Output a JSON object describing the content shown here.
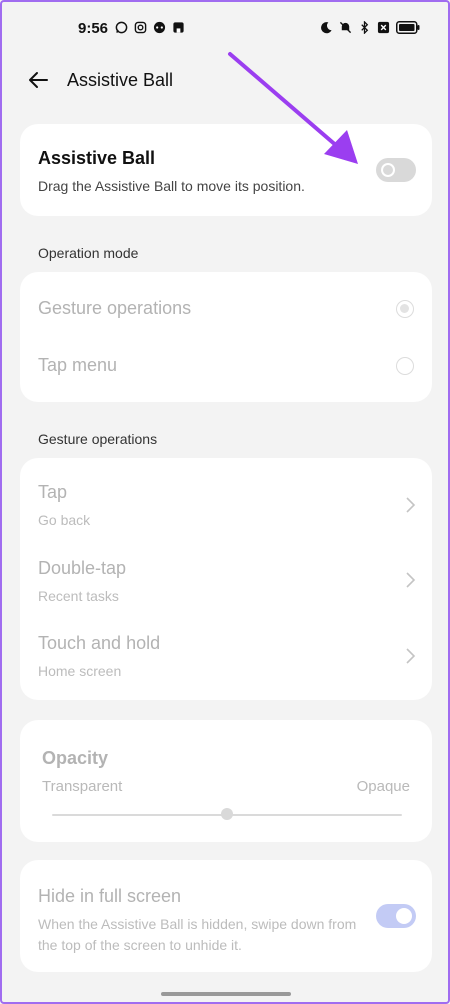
{
  "status_bar": {
    "time": "9:56",
    "left_icons": [
      "whatsapp-icon",
      "instagram-icon",
      "messenger-icon",
      "app-icon"
    ],
    "right_icons": [
      "moon-icon",
      "mute-icon",
      "bluetooth-icon",
      "close-box-icon",
      "battery-icon"
    ]
  },
  "header": {
    "title": "Assistive Ball"
  },
  "assistive_ball": {
    "title": "Assistive Ball",
    "description": "Drag the Assistive Ball to move its position.",
    "enabled": false
  },
  "operation_mode": {
    "label": "Operation mode",
    "options": [
      {
        "label": "Gesture operations",
        "selected": true
      },
      {
        "label": "Tap menu",
        "selected": false
      }
    ]
  },
  "gesture_operations": {
    "label": "Gesture operations",
    "items": [
      {
        "title": "Tap",
        "subtitle": "Go back"
      },
      {
        "title": "Double-tap",
        "subtitle": "Recent tasks"
      },
      {
        "title": "Touch and hold",
        "subtitle": "Home screen"
      }
    ]
  },
  "opacity": {
    "title": "Opacity",
    "left_label": "Transparent",
    "right_label": "Opaque",
    "value": 0.5
  },
  "hide_full_screen": {
    "title": "Hide in full screen",
    "description": "When the Assistive Ball is hidden, swipe down from the top of the screen to unhide it.",
    "enabled": true
  },
  "colors": {
    "annotation_arrow": "#9b3ef0",
    "toggle_on": "#c3cbf5",
    "background": "#f3f3f3"
  }
}
